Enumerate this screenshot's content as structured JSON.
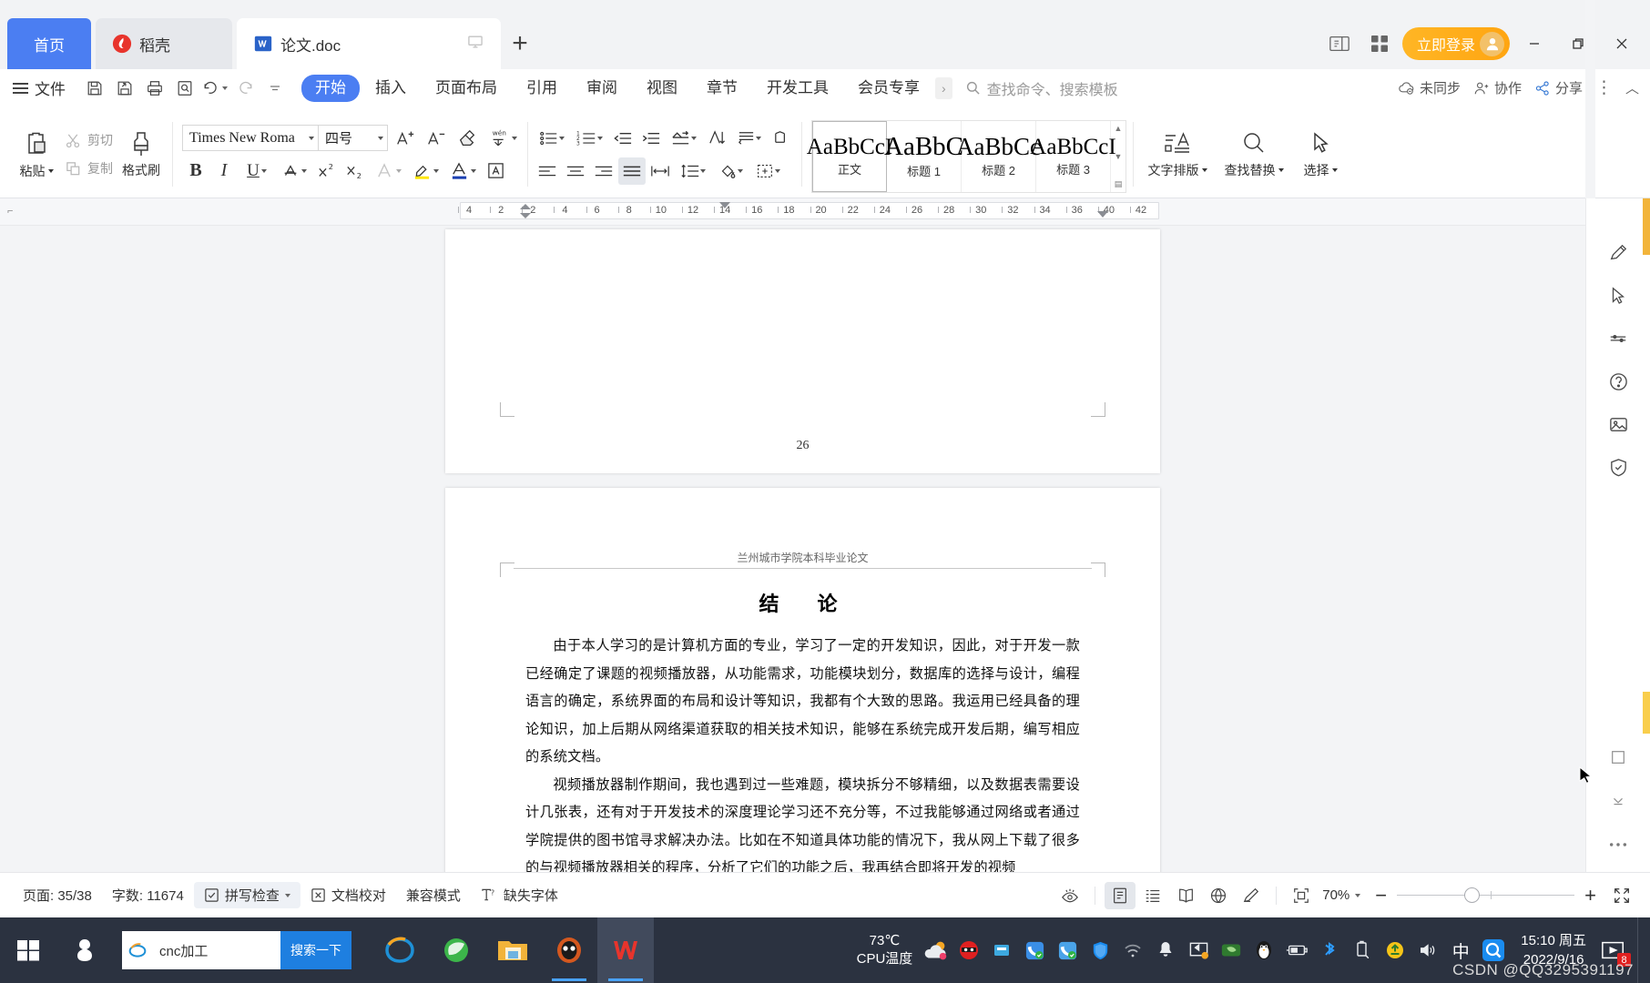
{
  "window": {
    "tabs": [
      {
        "label": "首页",
        "icon": "home-tab",
        "active": false
      },
      {
        "label": "稻壳",
        "icon": "docer-icon",
        "active": false
      },
      {
        "label": "论文.doc",
        "icon": "word-doc-icon",
        "active": true
      }
    ],
    "new_tab_label": "+",
    "login_label": "立即登录",
    "minimize": "−",
    "maximize": "❐",
    "close": "✕"
  },
  "menubar": {
    "file_label": "文件",
    "quick_access": [
      "save-icon",
      "save-as-icon",
      "print-icon",
      "print-preview-icon",
      "undo-icon",
      "redo-icon",
      "customize-icon"
    ],
    "ribbon_tabs": [
      {
        "label": "开始",
        "active": true
      },
      {
        "label": "插入",
        "active": false
      },
      {
        "label": "页面布局",
        "active": false
      },
      {
        "label": "引用",
        "active": false
      },
      {
        "label": "审阅",
        "active": false
      },
      {
        "label": "视图",
        "active": false
      },
      {
        "label": "章节",
        "active": false
      },
      {
        "label": "开发工具",
        "active": false
      },
      {
        "label": "会员专享",
        "active": false
      }
    ],
    "ribbon_more": "›",
    "search_placeholder": "查找命令、搜索模板",
    "sync_status": "未同步",
    "collaborate": "协作",
    "share": "分享",
    "more_label": "⋮",
    "collapse_label": "︿"
  },
  "ribbon": {
    "clipboard": {
      "paste": "粘贴",
      "cut": "剪切",
      "copy": "复制",
      "format_painter": "格式刷"
    },
    "font": {
      "family_value": "Times New Roma",
      "size_value": "四号",
      "grow": "A⁺",
      "shrink": "A⁻",
      "clear_format": "clear-format-icon",
      "pinyin": "拼音指南",
      "bold": "B",
      "italic": "I",
      "underline": "U",
      "strikethrough": "A",
      "superscript": "X²",
      "subscript": "X₂",
      "text_effect": "A",
      "highlight": "highlight-icon",
      "font_color": "font-color-icon",
      "char_border": "A"
    },
    "paragraph": {
      "bullets": "bullet-list-icon",
      "numbering": "numbered-list-icon",
      "decrease_indent": "decrease-indent-icon",
      "increase_indent": "increase-indent-icon",
      "multilevel": "multilevel-list-icon",
      "sort": "sort-icon",
      "show_marks": "show-marks-icon",
      "align_left": "align-left-icon",
      "align_center": "align-center-icon",
      "align_right": "align-right-icon",
      "align_justify": "align-justify-icon",
      "distribute": "distribute-icon",
      "line_spacing": "line-spacing-icon",
      "shading": "shading-icon",
      "borders": "borders-icon"
    },
    "styles": {
      "items": [
        {
          "preview": "AaBbCcI",
          "label": "正文",
          "selected": true
        },
        {
          "preview": "AaBbC",
          "label": "标题 1",
          "selected": false
        },
        {
          "preview": "AaBbCc",
          "label": "标题 2",
          "selected": false
        },
        {
          "preview": "AaBbCcI",
          "label": "标题 3",
          "selected": false
        }
      ]
    },
    "tools": {
      "typography": "文字排版",
      "find_replace": "查找替换",
      "select": "选择"
    }
  },
  "ruler": {
    "ticks": [
      "4",
      "2",
      "2",
      "4",
      "6",
      "8",
      "10",
      "12",
      "14",
      "16",
      "18",
      "20",
      "22",
      "24",
      "26",
      "28",
      "30",
      "32",
      "34",
      "36",
      "40",
      "42"
    ]
  },
  "document": {
    "prev_page_number": "26",
    "header": "兰州城市学院本科毕业论文",
    "title": "结　论",
    "paragraphs": [
      "由于本人学习的是计算机方面的专业，学习了一定的开发知识，因此，对于开发一款已经确定了课题的视频播放器，从功能需求，功能模块划分，数据库的选择与设计，编程语言的确定，系统界面的布局和设计等知识，我都有个大致的思路。我运用已经具备的理论知识，加上后期从网络渠道获取的相关技术知识，能够在系统完成开发后期，编写相应的系统文档。",
      "视频播放器制作期间，我也遇到过一些难题，模块拆分不够精细，以及数据表需要设计几张表，还有对于开发技术的深度理论学习还不充分等，不过我能够通过网络或者通过学院提供的图书馆寻求解决办法。比如在不知道具体功能的情况下，我从网上下载了很多的与视频播放器相关的程序，分析了它们的功能之后，我再结合即将开发的视频"
    ]
  },
  "rail": {
    "items": [
      "pen-edit-icon",
      "cursor-select-icon",
      "resize-icon",
      "help-circle-icon",
      "image-frame-icon",
      "shield-check-icon"
    ]
  },
  "statusbar": {
    "page_label": "页面: 35/38",
    "word_count": "字数: 11674",
    "spell_check": "拼写检查",
    "doc_proof": "文档校对",
    "compat_mode": "兼容模式",
    "missing_font": "缺失字体",
    "views": [
      "focus-eye-icon",
      "print-layout-icon",
      "outline-icon",
      "reading-icon",
      "web-layout-icon",
      "markup-icon"
    ],
    "fit_icon": "fit-page-icon",
    "zoom_value": "70%",
    "zoom_out": "−",
    "zoom_in": "+",
    "fullscreen": "fullscreen-icon"
  },
  "taskbar": {
    "start": "windows-start-icon",
    "pinned": [
      "antivirus-shield-icon"
    ],
    "search": {
      "value": "cnc加工",
      "button": "搜索一下",
      "icon": "ie-browser-icon"
    },
    "apps": [
      "ie-browser-icon",
      "360-browser-icon",
      "file-explorer-icon",
      "bandizip-icon",
      "wps-writer-icon"
    ],
    "cpu": {
      "temp": "73℃",
      "label": "CPU温度"
    },
    "tray": [
      "ninja-icon",
      "usb-device-icon",
      "phone-assistant-icon",
      "phone-assistant-2-icon",
      "tencent-security-icon",
      "wifi-icon",
      "bell-icon",
      "screen-share-icon",
      "nvidia-icon",
      "qq-penguin-icon",
      "battery-icon",
      "bluetooth-icon",
      "usb-eject-icon",
      "update-icon",
      "volume-icon",
      "ime-chinese-icon",
      "qq-browser-icon"
    ],
    "ime_label": "中",
    "clock": {
      "time": "15:10 周五",
      "date": "2022/9/16"
    },
    "notification_count": "8"
  },
  "watermark": "CSDN @QQ3295391197",
  "colors": {
    "accent_blue": "#4b7ef2",
    "login_orange": "#ffa511",
    "taskbar_bg": "#2b3240",
    "canvas_bg": "#f3f4f6"
  }
}
